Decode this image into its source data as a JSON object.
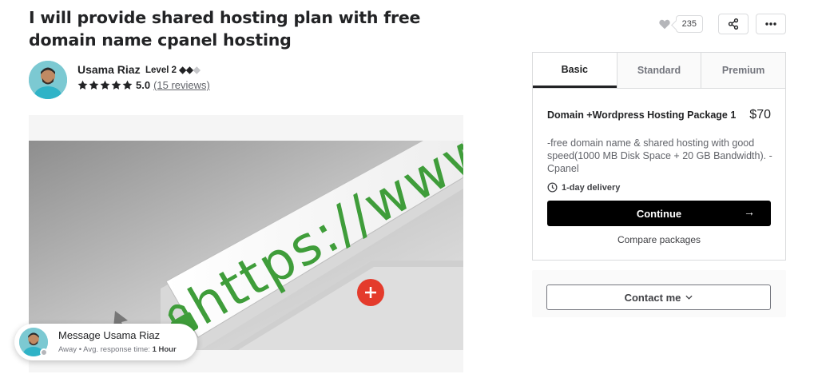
{
  "gig": {
    "title": "I will provide shared hosting plan with free domain name cpanel hosting"
  },
  "seller": {
    "name": "Usama Riaz",
    "level": "Level 2",
    "rating": "5.0",
    "reviews": "(15 reviews)"
  },
  "gallery": {
    "image_text": "https://www"
  },
  "actions": {
    "like_count": "235"
  },
  "message_bubble": {
    "title": "Message Usama Riaz",
    "status": "Away",
    "separator": "•",
    "response_label": "Avg. response time:",
    "response_value": "1 Hour"
  },
  "packages": {
    "tabs": [
      {
        "label": "Basic"
      },
      {
        "label": "Standard"
      },
      {
        "label": "Premium"
      }
    ],
    "active_tab": "Basic",
    "name": "Domain +Wordpress Hosting Package 1",
    "price": "$70",
    "description": "-free domain name & shared hosting with good speed(1000 MB Disk Space + 20 GB Bandwidth). -Cpanel",
    "delivery": "1-day delivery",
    "continue_label": "Continue",
    "compare_label": "Compare packages"
  },
  "contact": {
    "label": "Contact me"
  },
  "colors": {
    "primary_button": "#000000",
    "text_dark": "#222325",
    "border": "#dadbdd",
    "image_green": "#3f9d3a",
    "close_red": "#e43b2c"
  },
  "icons": {
    "heart": "heart-icon",
    "share": "share-icon",
    "more": "more-dots-icon",
    "star": "star-icon",
    "clock": "clock-icon",
    "arrow": "arrow-right-icon",
    "chevron": "chevron-down-icon"
  }
}
